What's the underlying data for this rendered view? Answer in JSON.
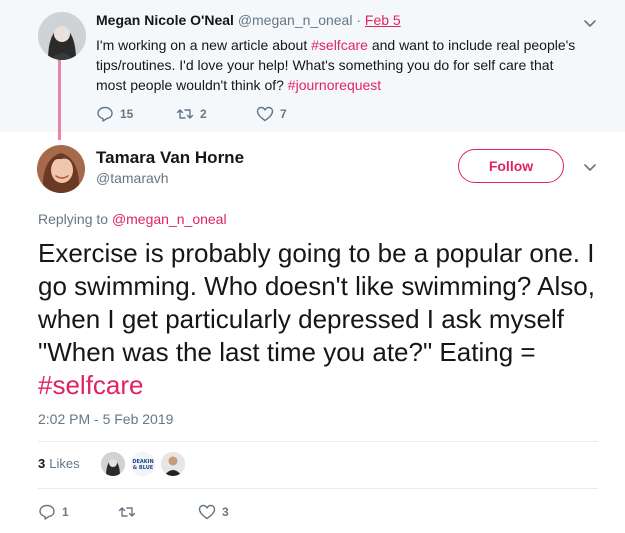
{
  "parent_tweet": {
    "name": "Megan Nicole O'Neal",
    "handle": "@megan_n_oneal",
    "separator": "·",
    "date": "Feb 5",
    "text_part1": "I'm working on a new article about ",
    "hashtag1": "#selfcare",
    "text_part2": " and want to include real people's tips/routines. I'd love your help! What's something you do for self care that most people wouldn't think of? ",
    "hashtag2": "#journorequest",
    "reply_count": "15",
    "retweet_count": "2",
    "like_count": "7"
  },
  "main_tweet": {
    "name": "Tamara Van Horne",
    "handle": "@tamaravh",
    "follow_label": "Follow",
    "replying_prefix": "Replying to ",
    "replying_to": "@megan_n_oneal",
    "text": "Exercise is probably going to be a popular one. I go swimming. Who doesn't like swimming? Also, when I get particularly depressed I ask myself \"When was the last time you ate?\" Eating = ",
    "hashtag": "#selfcare",
    "timestamp": "2:02 PM - 5 Feb 2019",
    "likes_count": "3",
    "likes_label": "Likes",
    "reply_count": "1",
    "retweet_count": "",
    "like_count": "3"
  },
  "likers": [
    "liker-1-avatar",
    "DEAKIN & BLUE",
    "liker-3-avatar"
  ],
  "colors": {
    "accent": "#e0245e",
    "secondary_text": "#657786",
    "parent_bg": "#f5f8fa",
    "divider": "#e6ecf0"
  },
  "icons": [
    "reply-icon",
    "retweet-icon",
    "heart-icon",
    "chevron-down-icon"
  ]
}
